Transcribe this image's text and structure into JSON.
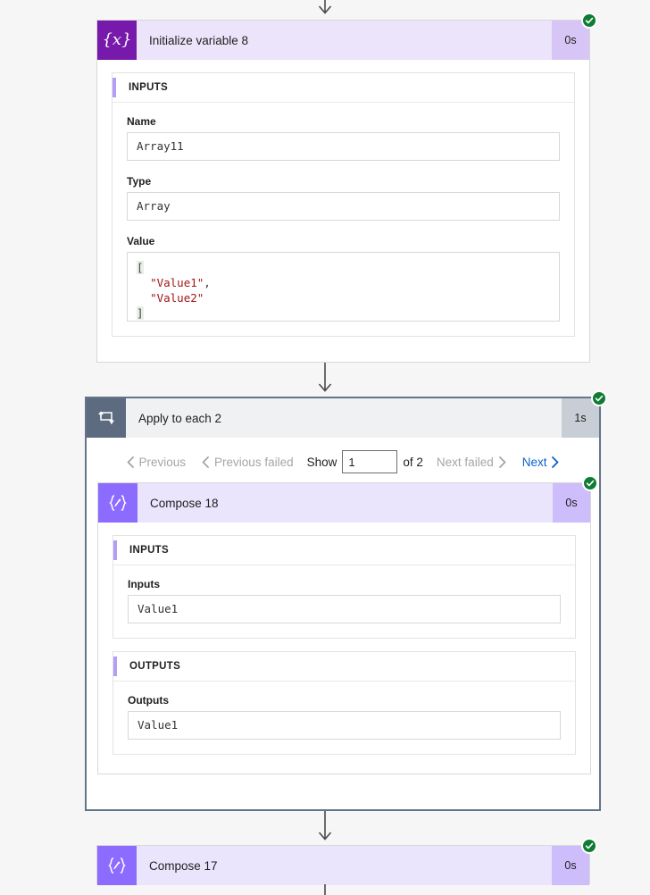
{
  "theme": {
    "page_background": "#f6f6f6",
    "variable_icon_color": "#7719aa",
    "compose_icon_color": "#8c6cff",
    "loop_icon_color": "#5c6b80",
    "success_color": "#0f7c33",
    "link_color": "#0a62c9",
    "disabled_color": "#a5a5a5",
    "section_accent_color": "#b59cf7",
    "string_literal_color": "#a31515"
  },
  "flow": {
    "actions": [
      {
        "id": "initialize-variable-8",
        "title": "Initialize variable 8",
        "icon": "braces-x-icon",
        "duration": "0s",
        "status": "succeeded",
        "sections": [
          {
            "title": "INPUTS",
            "fields": [
              {
                "label": "Name",
                "value": "Array11",
                "type": "text"
              },
              {
                "label": "Type",
                "value": "Array",
                "type": "text"
              },
              {
                "label": "Value",
                "type": "code",
                "lines": [
                  {
                    "bracket": "[",
                    "text": ""
                  },
                  {
                    "indent": 1,
                    "string": "\"Value1\"",
                    "suffix": ","
                  },
                  {
                    "indent": 1,
                    "string": "\"Value2\"",
                    "suffix": ""
                  },
                  {
                    "bracket": "]",
                    "text": ""
                  }
                ]
              }
            ]
          }
        ]
      },
      {
        "id": "apply-to-each-2",
        "title": "Apply to each 2",
        "icon": "loop-icon",
        "duration": "1s",
        "status": "succeeded",
        "pagination": {
          "previous_label": "Previous",
          "previous_failed_label": "Previous failed",
          "show_label": "Show",
          "current_page": "1",
          "of_label": "of 2",
          "next_failed_label": "Next failed",
          "next_label": "Next"
        },
        "children": [
          {
            "id": "compose-18",
            "title": "Compose 18",
            "icon": "braces-pen-icon",
            "duration": "0s",
            "status": "succeeded",
            "sections": [
              {
                "title": "INPUTS",
                "fields": [
                  {
                    "label": "Inputs",
                    "value": "Value1",
                    "type": "text"
                  }
                ]
              },
              {
                "title": "OUTPUTS",
                "fields": [
                  {
                    "label": "Outputs",
                    "value": "Value1",
                    "type": "text"
                  }
                ]
              }
            ]
          }
        ]
      },
      {
        "id": "compose-17",
        "title": "Compose 17",
        "icon": "braces-pen-icon",
        "duration": "0s",
        "status": "succeeded",
        "sections": []
      }
    ]
  }
}
